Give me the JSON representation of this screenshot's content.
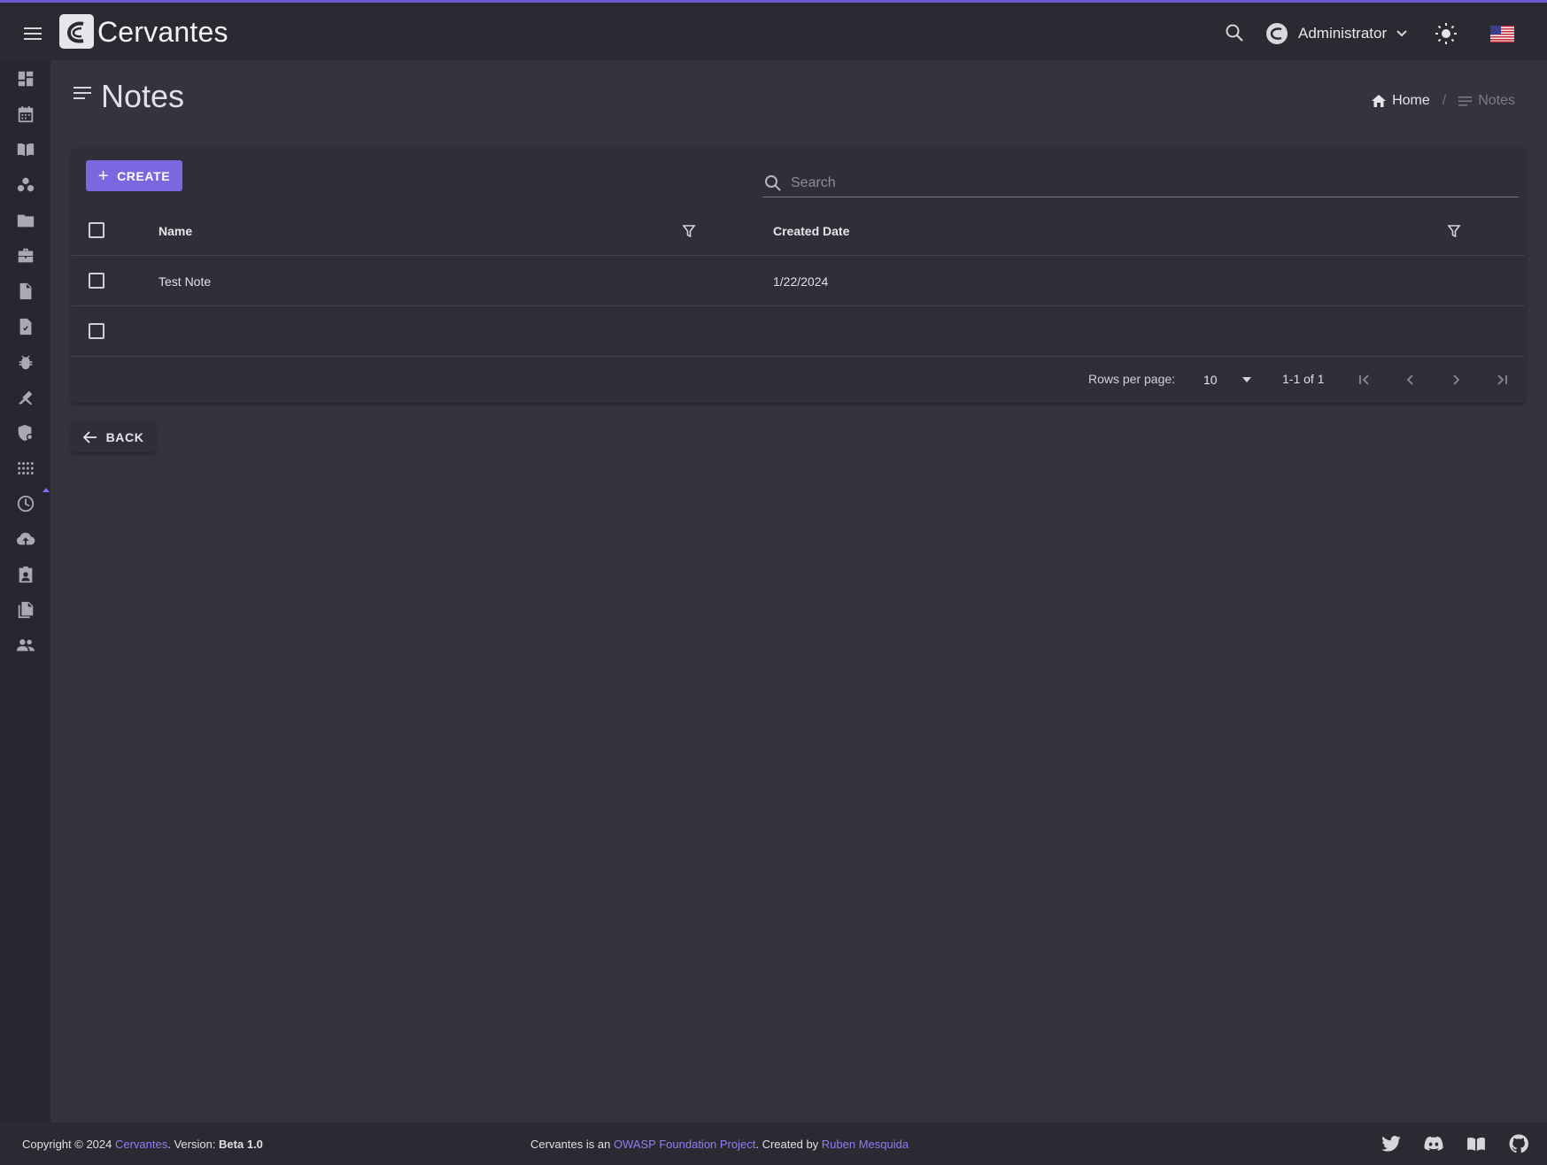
{
  "app": {
    "title": "Cervantes"
  },
  "header": {
    "user_name": "Administrator"
  },
  "sidebar": {
    "items": [
      {
        "name": "dashboard"
      },
      {
        "name": "calendar"
      },
      {
        "name": "workspaces"
      },
      {
        "name": "clients"
      },
      {
        "name": "projects"
      },
      {
        "name": "jobs"
      },
      {
        "name": "documents"
      },
      {
        "name": "reports"
      },
      {
        "name": "vulns"
      },
      {
        "name": "targets"
      },
      {
        "name": "security"
      },
      {
        "name": "apps"
      },
      {
        "name": "history"
      },
      {
        "name": "upload"
      },
      {
        "name": "contacts"
      },
      {
        "name": "files"
      },
      {
        "name": "users"
      }
    ]
  },
  "page": {
    "title": "Notes"
  },
  "breadcrumb": {
    "home": "Home",
    "separator": "/",
    "current": "Notes"
  },
  "toolbar": {
    "create_label": "CREATE",
    "search_placeholder": "Search"
  },
  "table": {
    "columns": [
      "Name",
      "Created Date"
    ],
    "rows": [
      {
        "name": "Test Note",
        "created": "1/22/2024"
      },
      {
        "name": "",
        "created": ""
      }
    ]
  },
  "pagination": {
    "rows_per_page_label": "Rows per page:",
    "rows_per_page": "10",
    "range": "1-1 of 1"
  },
  "back_label": "BACK",
  "footer": {
    "copyright_prefix": "Copyright © 2024 ",
    "brand_link": "Cervantes",
    "version_prefix": ". Version: ",
    "version": "Beta 1.0",
    "about_prefix": "Cervantes is an ",
    "owasp_link": "OWASP Foundation Project",
    "created_by": ". Created by ",
    "author_link": "Ruben Mesquida"
  },
  "colors": {
    "accent": "#7b68e0",
    "link": "#8f7ef5",
    "background": "#34343f",
    "topbar": "#2a2a33"
  }
}
